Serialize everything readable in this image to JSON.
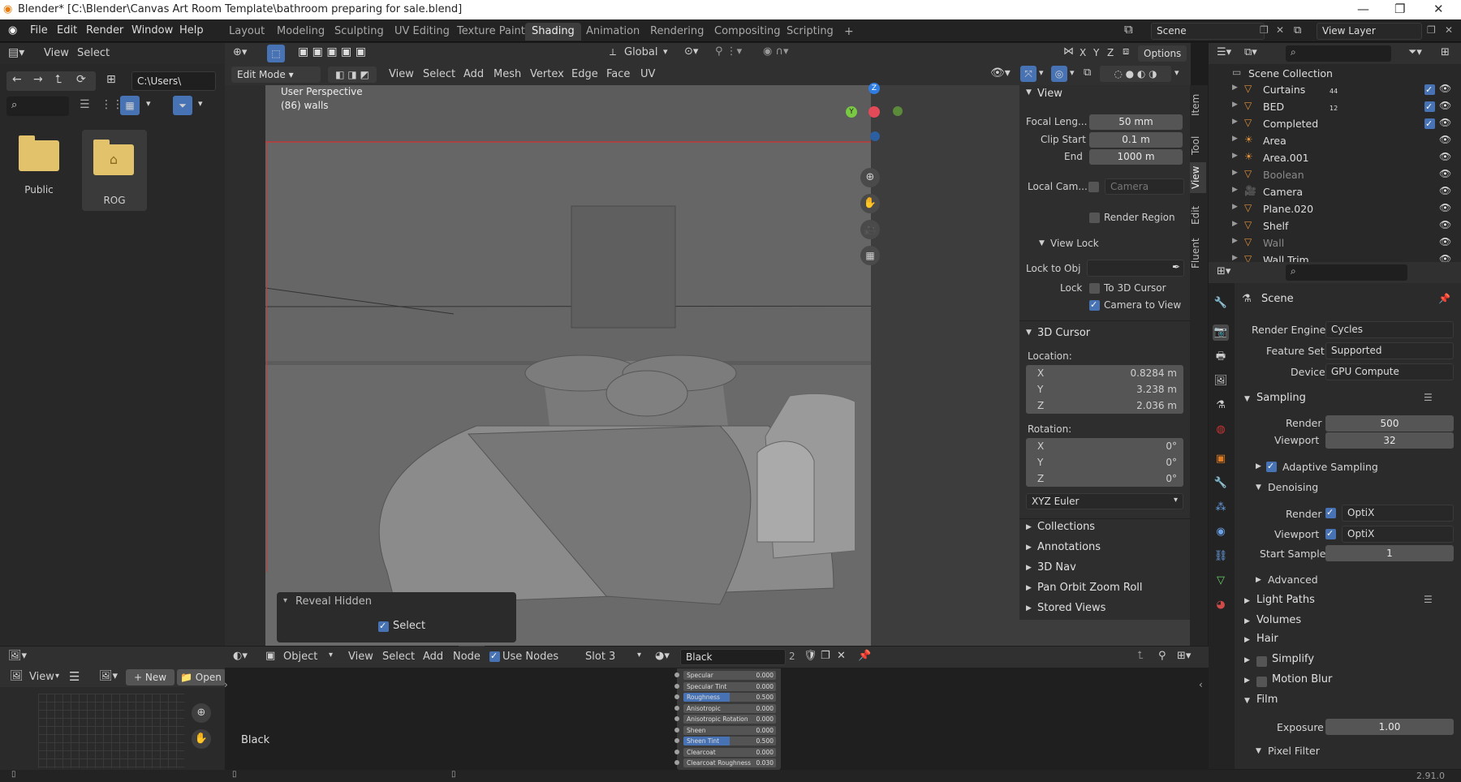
{
  "title_bar": {
    "title": "Blender* [C:\\Blender\\Canvas Art Room Template\\bathroom  preparing for sale.blend]"
  },
  "menus": [
    "File",
    "Edit",
    "Render",
    "Window",
    "Help"
  ],
  "workspaces": [
    "Layout",
    "Modeling",
    "Sculpting",
    "UV Editing",
    "Texture Paint",
    "Shading",
    "Animation",
    "Rendering",
    "Compositing",
    "Scripting"
  ],
  "active_workspace": "Shading",
  "scene": {
    "name": "Scene",
    "view_layer": "View Layer"
  },
  "file_browser": {
    "menu": [
      "View",
      "Select"
    ],
    "path": "C:\\Users\\",
    "folders": [
      "Public",
      "ROG"
    ]
  },
  "viewport_header1": {
    "orientation": "Global",
    "axes": [
      "X",
      "Y",
      "Z"
    ],
    "options": "Options"
  },
  "viewport_header2": {
    "mode": "Edit Mode",
    "menus": [
      "View",
      "Select",
      "Add",
      "Mesh",
      "Vertex",
      "Edge",
      "Face",
      "UV"
    ]
  },
  "viewport": {
    "perspective": "User Perspective",
    "object_info": "(86) walls"
  },
  "gizmo": {
    "z": "Z",
    "y": "Y"
  },
  "reveal_panel": {
    "title": "Reveal Hidden",
    "select_label": "Select"
  },
  "side_tabs": [
    "Item",
    "Tool",
    "View",
    "Edit",
    "Fluent"
  ],
  "view_panel": {
    "title": "View",
    "focal_label": "Focal Leng...",
    "focal_value": "50 mm",
    "clip_start_label": "Clip Start",
    "clip_start_value": "0.1 m",
    "end_label": "End",
    "end_value": "1000 m",
    "local_cam_label": "Local Cam...",
    "camera_placeholder": "Camera",
    "render_region": "Render Region",
    "view_lock_title": "View Lock",
    "lock_to_obj": "Lock to Obj",
    "lock_label": "Lock",
    "to_3d_cursor": "To 3D Cursor",
    "camera_to_view": "Camera to View"
  },
  "cursor_panel": {
    "title": "3D Cursor",
    "location_label": "Location:",
    "loc": [
      {
        "axis": "X",
        "value": "0.8284 m"
      },
      {
        "axis": "Y",
        "value": "3.238 m"
      },
      {
        "axis": "Z",
        "value": "2.036 m"
      }
    ],
    "rotation_label": "Rotation:",
    "rot": [
      {
        "axis": "X",
        "value": "0°"
      },
      {
        "axis": "Y",
        "value": "0°"
      },
      {
        "axis": "Z",
        "value": "0°"
      }
    ],
    "mode": "XYZ Euler"
  },
  "collapsed_panels": [
    "Collections",
    "Annotations",
    "3D Nav",
    "Pan Orbit Zoom Roll",
    "Stored Views"
  ],
  "outliner": {
    "root": "Scene Collection",
    "items": [
      {
        "name": "Curtains",
        "badge": "44"
      },
      {
        "name": "BED",
        "badge": "12"
      },
      {
        "name": "Completed",
        "badge": ""
      },
      {
        "name": "Area",
        "badge": ""
      },
      {
        "name": "Area.001",
        "badge": ""
      },
      {
        "name": "Boolean",
        "badge": ""
      },
      {
        "name": "Camera",
        "badge": ""
      },
      {
        "name": "Plane.020",
        "badge": ""
      },
      {
        "name": "Shelf",
        "badge": ""
      },
      {
        "name": "Wall",
        "badge": ""
      },
      {
        "name": "Wall Trim",
        "badge": ""
      }
    ]
  },
  "properties": {
    "scene_label": "Scene",
    "render_engine_label": "Render Engine",
    "render_engine": "Cycles",
    "feature_set_label": "Feature Set",
    "feature_set": "Supported",
    "device_label": "Device",
    "device": "GPU Compute",
    "sampling": "Sampling",
    "render_label": "Render",
    "render_samples": "500",
    "viewport_label": "Viewport",
    "viewport_samples": "32",
    "adaptive_sampling": "Adaptive Sampling",
    "denoising": "Denoising",
    "denoise_render_label": "Render",
    "denoise_render": "OptiX",
    "denoise_viewport_label": "Viewport",
    "denoise_viewport": "OptiX",
    "start_sample_label": "Start Sample",
    "start_sample": "1",
    "advanced": "Advanced",
    "light_paths": "Light Paths",
    "volumes": "Volumes",
    "hair": "Hair",
    "simplify": "Simplify",
    "motion_blur": "Motion Blur",
    "film": "Film",
    "exposure_label": "Exposure",
    "exposure": "1.00",
    "pixel_filter": "Pixel Filter"
  },
  "image_editor": {
    "view": "View",
    "new": "New",
    "open": "Open"
  },
  "node_editor": {
    "object": "Object",
    "menus": [
      "View",
      "Select",
      "Add",
      "Node"
    ],
    "use_nodes": "Use Nodes",
    "slot": "Slot 3",
    "material": "Black",
    "users": "2",
    "label": "Black",
    "sockets": [
      {
        "name": "Specular",
        "value": "0.000",
        "hl": false
      },
      {
        "name": "Specular Tint",
        "value": "0.000",
        "hl": false
      },
      {
        "name": "Roughness",
        "value": "0.500",
        "hl": true
      },
      {
        "name": "Anisotropic",
        "value": "0.000",
        "hl": false
      },
      {
        "name": "Anisotropic Rotation",
        "value": "0.000",
        "hl": false
      },
      {
        "name": "Sheen",
        "value": "0.000",
        "hl": false
      },
      {
        "name": "Sheen Tint",
        "value": "0.500",
        "hl": true
      },
      {
        "name": "Clearcoat",
        "value": "0.000",
        "hl": false
      },
      {
        "name": "Clearcoat Roughness",
        "value": "0.030",
        "hl": false
      }
    ]
  },
  "status_bar": {
    "version": "2.91.0"
  }
}
